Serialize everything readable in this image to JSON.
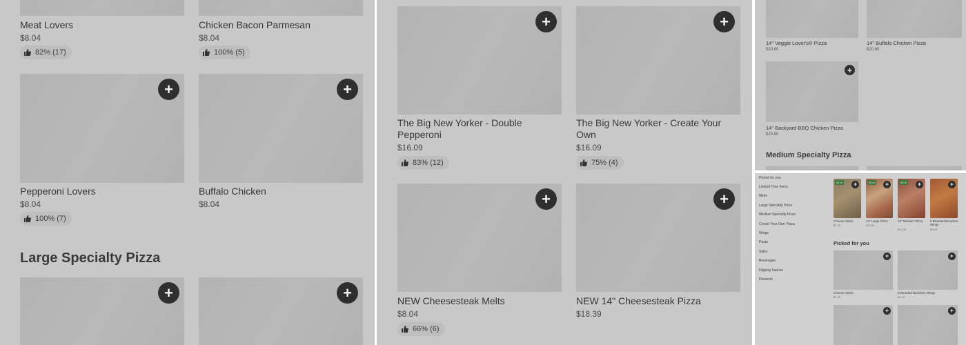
{
  "panel1": {
    "section_title": "Large Specialty Pizza",
    "items": [
      {
        "name": "Meat Lovers",
        "price": "$8.04",
        "rating": "82% (17)"
      },
      {
        "name": "Chicken Bacon Parmesan",
        "price": "$8.04",
        "rating": "100% (5)"
      },
      {
        "name": "Pepperoni Lovers",
        "price": "$8.04",
        "rating": "100% (7)"
      },
      {
        "name": "Buffalo Chicken",
        "price": "$8.04",
        "rating": ""
      }
    ]
  },
  "panel2": {
    "items": [
      {
        "name": "The Big New Yorker - Double Pepperoni",
        "price": "$16.09",
        "rating": "83% (12)"
      },
      {
        "name": "The Big New Yorker - Create Your Own",
        "price": "$16.09",
        "rating": "75% (4)"
      },
      {
        "name": "NEW Cheesesteak Melts",
        "price": "$8.04",
        "rating": "66% (6)"
      },
      {
        "name": "NEW 14\" Cheesesteak Pizza",
        "price": "$18.39",
        "rating": ""
      }
    ]
  },
  "panel3": {
    "items": [
      {
        "name": "14\" Veggie Lover's® Pizza",
        "price": "$20.80"
      },
      {
        "name": "14\" Buffalo Chicken Pizza",
        "price": "$20.80"
      },
      {
        "name": "14\" Backyard BBQ Chicken Pizza",
        "price": "$20.80"
      }
    ],
    "section_title": "Medium Specialty Pizza"
  },
  "panel4": {
    "sidebar": [
      "Picked for you",
      "Limited Time Items",
      "Melts",
      "Large Specialty Pizza",
      "Medium Specialty Pizza",
      "Create Your Own Pizza",
      "Wings",
      "Pasta",
      "Sides",
      "Beverages",
      "Dipping Sauces",
      "Desserts"
    ],
    "featured": [
      {
        "name": "Cheese Sticks",
        "price": "$7.49",
        "badge": "#1 m"
      },
      {
        "name": "14\" Large Pizza",
        "price": "$20.63",
        "badge": "#2 m"
      },
      {
        "name": "12\" Medium Pizza",
        "price": "$15.35",
        "badge": "#3 m"
      },
      {
        "name": "8 Breaded Boneless Wings",
        "price": "$9.19",
        "badge": ""
      }
    ],
    "section_title": "Picked for you",
    "picked": [
      {
        "name": "Cheese Sticks",
        "price": "$7.49"
      },
      {
        "name": "8 Breaded Boneless Wings",
        "price": "$9.19"
      }
    ]
  },
  "colors": {
    "overlay": "#c8c8c8",
    "image_placeholder": "#b6b6b6",
    "add_button": "#2f2f2f",
    "rating_pill": "#bebebe",
    "badge_green": "#3f7a3f"
  },
  "icons": {
    "add": "plus-icon",
    "rating": "thumbs-up-icon"
  },
  "glyphs": {
    "plus": "+"
  }
}
